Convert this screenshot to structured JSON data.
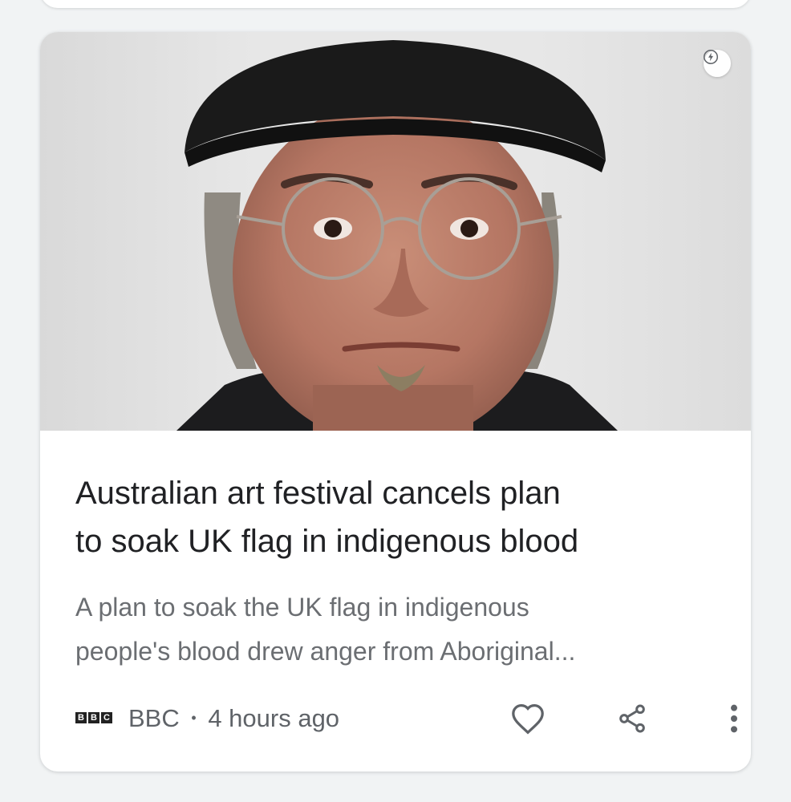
{
  "article": {
    "headline_line1": "Australian art festival cancels plan",
    "headline_line2": "to soak UK flag in indigenous blood",
    "snippet_line1": "A plan to soak the UK flag in indigenous",
    "snippet_line2": "people's blood drew anger from Aboriginal...",
    "source_logo_letters": [
      "B",
      "B",
      "C"
    ],
    "source": "BBC",
    "separator": "•",
    "time": "4 hours ago",
    "image_subject": "portrait-of-man-in-black-cap-and-round-glasses",
    "badge_icon": "amp-lightning-icon"
  },
  "actions": {
    "like_icon": "heart-outline-icon",
    "share_icon": "share-icon",
    "more_icon": "more-vert-icon"
  },
  "colors": {
    "page_background": "#f1f3f4",
    "card_background": "#ffffff",
    "headline": "#202124",
    "snippet": "#6b6e72",
    "meta": "#5f6368",
    "icons": "#5f6368"
  }
}
